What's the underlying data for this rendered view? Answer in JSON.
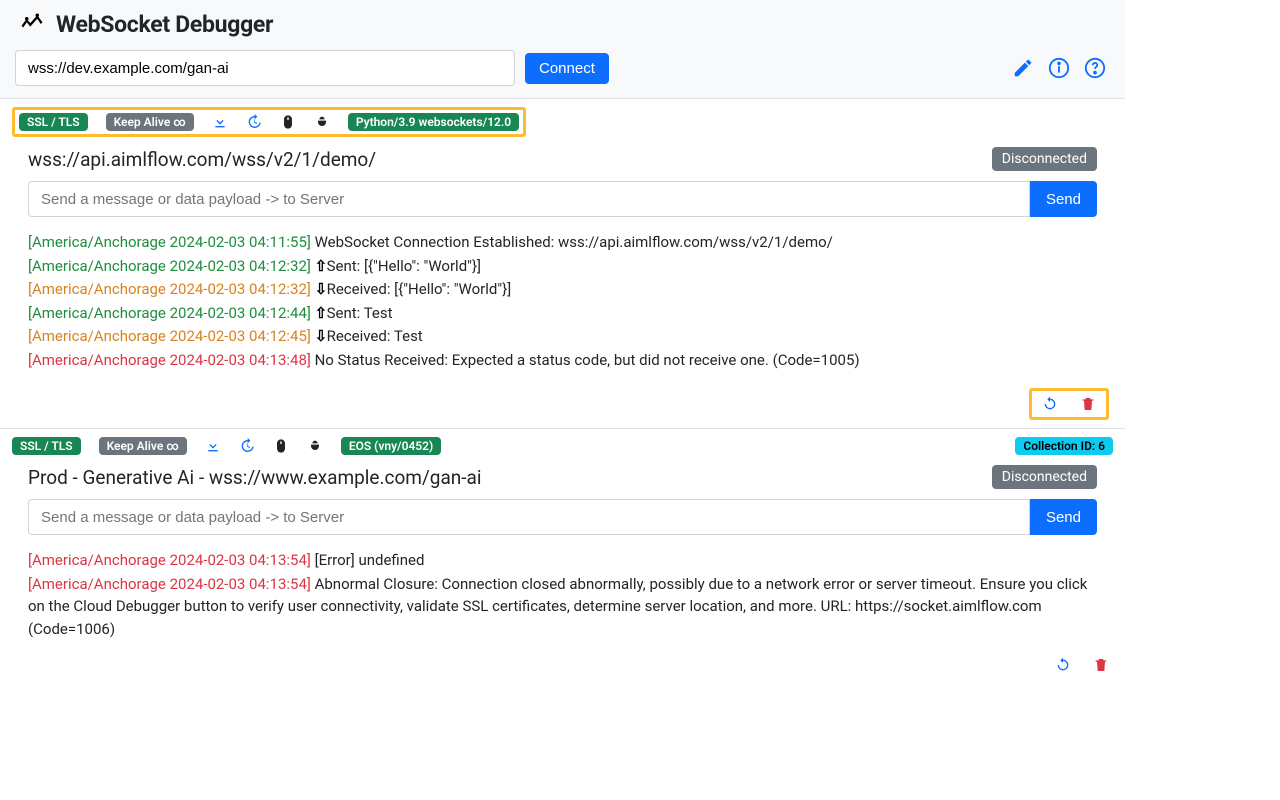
{
  "app": {
    "title": "WebSocket Debugger"
  },
  "connect": {
    "url_value": "wss://dev.example.com/gan-ai",
    "button": "Connect"
  },
  "common": {
    "ssl_label": "SSL / TLS",
    "keepalive_label": "Keep Alive ∞",
    "msg_placeholder": "Send a message or data payload -> to Server",
    "send_label": "Send",
    "disconnected_label": "Disconnected"
  },
  "panel1": {
    "server_pill": "Python/3.9 websockets/12.0",
    "title": "wss://api.aimlflow.com/wss/v2/1/demo/",
    "log": [
      {
        "ts": "[America/Anchorage 2024-02-03 04:11:55]",
        "ts_cls": "ts-green",
        "arrow": "",
        "msg": "WebSocket Connection Established: wss://api.aimlflow.com/wss/v2/1/demo/"
      },
      {
        "ts": "[America/Anchorage 2024-02-03 04:12:32]",
        "ts_cls": "ts-green",
        "arrow": "⇧",
        "msg": "Sent: [{\"Hello\": \"World\"}]"
      },
      {
        "ts": "[America/Anchorage 2024-02-03 04:12:32]",
        "ts_cls": "ts-orange",
        "arrow": "⇩",
        "msg": "Received: [{\"Hello\": \"World\"}]"
      },
      {
        "ts": "[America/Anchorage 2024-02-03 04:12:44]",
        "ts_cls": "ts-green",
        "arrow": "⇧",
        "msg": "Sent: Test"
      },
      {
        "ts": "[America/Anchorage 2024-02-03 04:12:45]",
        "ts_cls": "ts-orange",
        "arrow": "⇩",
        "msg": "Received: Test"
      },
      {
        "ts": "[America/Anchorage 2024-02-03 04:13:48]",
        "ts_cls": "ts-red",
        "arrow": "",
        "msg": "No Status Received: Expected a status code, but did not receive one. (Code=1005)"
      }
    ]
  },
  "panel2": {
    "server_pill": "EOS (vny/0452)",
    "collection_pill": "Collection ID: 6",
    "title": "Prod - Generative Ai - wss://www.example.com/gan-ai",
    "log": [
      {
        "ts": "[America/Anchorage 2024-02-03 04:13:54]",
        "ts_cls": "ts-red",
        "arrow": "",
        "msg": "[Error] undefined"
      },
      {
        "ts": "[America/Anchorage 2024-02-03 04:13:54]",
        "ts_cls": "ts-red",
        "arrow": "",
        "msg": "Abnormal Closure: Connection closed abnormally, possibly due to a network error or server timeout. Ensure you click on the Cloud Debugger button to verify user connectivity, validate SSL certificates, determine server location, and more. URL: https://socket.aimlflow.com (Code=1006)"
      }
    ]
  }
}
